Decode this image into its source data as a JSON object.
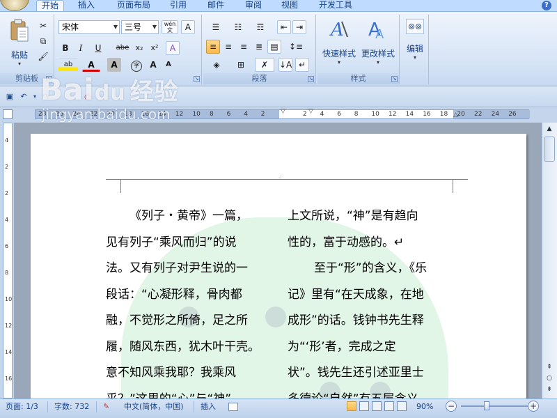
{
  "tabs": [
    "开始",
    "插入",
    "页面布局",
    "引用",
    "邮件",
    "审阅",
    "视图",
    "开发工具"
  ],
  "ribbon": {
    "clipboard": {
      "paste_label": "粘贴",
      "group_label": "剪贴板"
    },
    "font": {
      "font_name": "宋体",
      "font_size": "三号",
      "phonetic_label": "wén",
      "char_border_label": "A",
      "bold": "B",
      "italic": "I",
      "underline": "U",
      "strike": "abe",
      "subscript": "x₂",
      "superscript": "x²",
      "clear_format": "A",
      "highlight": "ab",
      "font_color": "A",
      "char_shade": "A",
      "enclose": "字",
      "grow": "A",
      "shrink": "A"
    },
    "paragraph": {
      "group_label": "段落"
    },
    "styles": {
      "quick_styles_label": "快速样式",
      "change_styles_label": "更改样式",
      "group_label": "样式"
    },
    "editing": {
      "label": "编辑"
    }
  },
  "ruler": {
    "left_ticks": [
      "28",
      "26",
      "24",
      "22",
      "20",
      "18",
      "16",
      "14",
      "12",
      "10",
      "8",
      "6",
      "4",
      "2"
    ],
    "right_ticks": [
      "2",
      "4",
      "6",
      "8",
      "10",
      "12",
      "14",
      "16",
      "18",
      "20",
      "22",
      "24",
      "26"
    ]
  },
  "vruler_ticks": [
    "4",
    "2",
    "2",
    "4",
    "6",
    "8",
    "10",
    "12",
    "14",
    "16"
  ],
  "document": {
    "header_mark": ".:",
    "left_column": [
      "《列子・黄帝》一篇，",
      "见有列子“乘风而归”的说",
      "法。又有列子对尹生说的一",
      "段话：“心凝形释，骨肉都",
      "融，不觉形之所倚，足之所",
      "履，随风东西，犹木叶干壳。",
      "意不知风乘我耶？我乘风",
      "乎？”这里的“心”与“神”"
    ],
    "right_column": [
      "上文所说，“神”是有趋向",
      "性的，富于动感的。↵",
      "至于“形”的含义，《乐",
      "记》里有“在天成象，在地",
      "成形”的话。钱钟书先生释",
      "为“‘形’者，完成之定",
      "状”。钱先生还引述亚里士",
      "多德论“自然”有五层含义。"
    ]
  },
  "status": {
    "page": "页面: 1/3",
    "words": "字数: 732",
    "language": "中文(简体，中国)",
    "insert_mode": "插入",
    "zoom": "90%",
    "zoom_minus": "−",
    "zoom_plus": "+"
  },
  "watermark": {
    "brand": "Bai",
    "paw": "du",
    "suffix": "经验",
    "url": "jingyan.baidu.com"
  }
}
